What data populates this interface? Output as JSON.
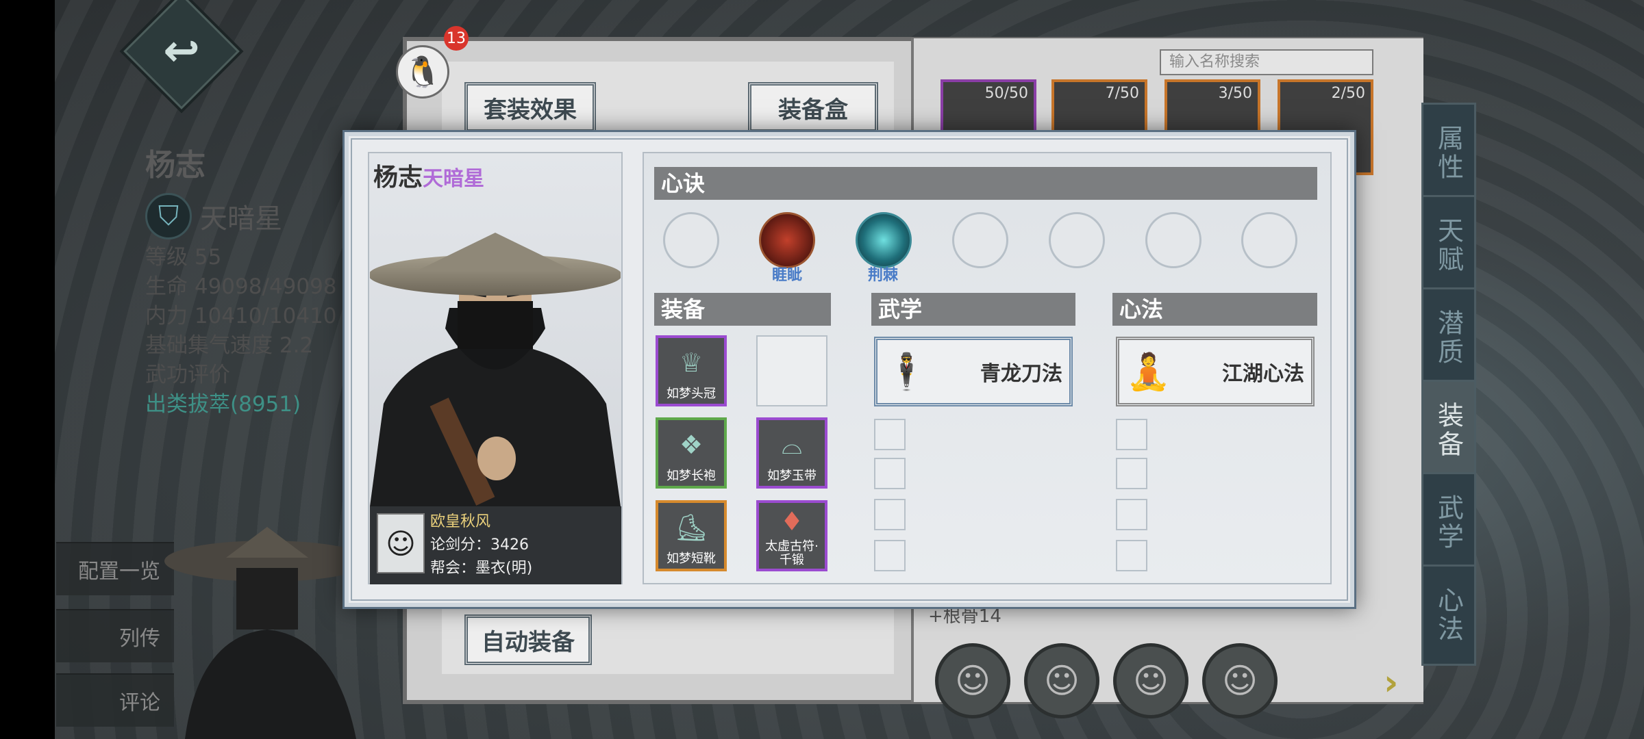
{
  "background": {
    "hero_name": "杨志",
    "star_name": "天暗星",
    "stats": {
      "level": "等级 55",
      "hp": "生命 49098/49098",
      "mp": "内力 10410/10410",
      "qi_speed": "基础集气速度 2.2",
      "rating_label": "武功评价",
      "rating_value": "出类拔萃(8951)"
    },
    "side_buttons": [
      "配置一览",
      "列传",
      "评论"
    ],
    "notification_count": "13",
    "book_left_buttons": {
      "set_effect": "套装效果",
      "equip_box": "装备盒",
      "auto_equip": "自动装备"
    },
    "search_placeholder": "输入名称搜索",
    "inventory_counts": [
      "50/50",
      "7/50",
      "3/50",
      "2/50"
    ],
    "skill_text": "+根骨14",
    "right_tabs": [
      "属性",
      "天赋",
      "潜质",
      "装备",
      "武学",
      "心法"
    ],
    "next_arrow": "›"
  },
  "modal": {
    "hero_name": "杨志",
    "hero_star": "天暗星",
    "owner": {
      "name": "欧皇秋风",
      "score": "论剑分：3426",
      "guild": "帮会：墨衣(明)"
    },
    "sections": {
      "xinjue": "心诀",
      "equip": "装备",
      "wuxue": "武学",
      "xinfa": "心法"
    },
    "xinjue_labels": [
      "睚眦",
      "荆棘"
    ],
    "equipment": [
      {
        "name": "如梦头冠",
        "rarity": "purple",
        "icon": "crown-icon"
      },
      {
        "name": "",
        "rarity": "empty",
        "icon": ""
      },
      {
        "name": "如梦长袍",
        "rarity": "green",
        "icon": "robe-icon"
      },
      {
        "name": "如梦玉带",
        "rarity": "purple",
        "icon": "belt-icon"
      },
      {
        "name": "如梦短靴",
        "rarity": "orange",
        "icon": "boots-icon"
      },
      {
        "name": "太虚古符·千锻",
        "rarity": "purple",
        "icon": "talisman-icon"
      }
    ],
    "martial_art": "青龙刀法",
    "mental_art": "江湖心法"
  },
  "colors": {
    "purple_rarity": "#9b4bd0",
    "green_rarity": "#5ea84a",
    "orange_rarity": "#d68a2d",
    "star_name_color": "#b06bd7",
    "teal_rating": "#3e9086",
    "badge_red": "#d9352c"
  }
}
